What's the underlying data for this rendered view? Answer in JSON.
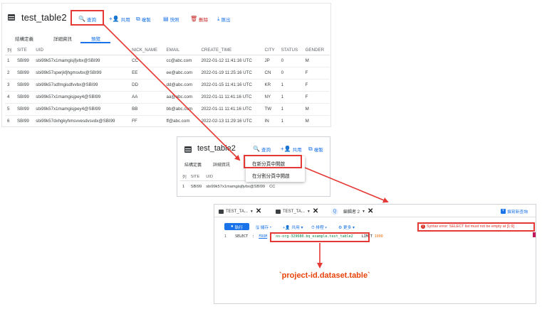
{
  "panel1": {
    "title": "test_table2",
    "toolbar": [
      {
        "label": "查詢",
        "icon": "search-icon",
        "glyph": "🔍"
      },
      {
        "label": "共用",
        "icon": "person-add-icon",
        "glyph": "+👤"
      },
      {
        "label": "複製",
        "icon": "copy-icon",
        "glyph": "⧉"
      },
      {
        "label": "快照",
        "icon": "snapshot-icon",
        "glyph": "▤"
      },
      {
        "label": "刪除",
        "icon": "delete-icon",
        "glyph": "🗑"
      },
      {
        "label": "匯出",
        "icon": "export-icon",
        "glyph": "⤓"
      }
    ],
    "subtabs": [
      "結構定義",
      "詳細資訊",
      "預覽"
    ],
    "selected_subtab": "預覽",
    "columns": [
      "列",
      "SITE",
      "UID",
      "NICK_NAME",
      "EMAIL",
      "CREATE_TIME",
      "CITY",
      "STATUS",
      "GENDER"
    ],
    "rows": [
      [
        "1",
        "SBI99",
        "sbi99k57x1mamgisjfjvbx@SBI99",
        "CC",
        "cc@abc.com",
        "2022-01-12 11:41:16 UTC",
        "JP",
        "0",
        "M"
      ],
      [
        "2",
        "SBI99",
        "sbi99k57sperjkfjhgmsvbx@SBI99",
        "EE",
        "ee@abc.com",
        "2022-01-19 11:25:16 UTC",
        "CN",
        "0",
        "F"
      ],
      [
        "3",
        "SBI99",
        "sbi99k57sdfmgisdfvvbx@SBI99",
        "DD",
        "dd@abc.com",
        "2022-01-15 11:41:16 UTC",
        "KR",
        "1",
        "F"
      ],
      [
        "4",
        "SBI99",
        "sbi99k57x1mamgisjpey4@SBI99",
        "AA",
        "aa@abc.com",
        "2022-01-11 11:41:16 UTC",
        "NY",
        "1",
        "F"
      ],
      [
        "5",
        "SBI99",
        "sbi99k57x1mamgisjpey4@SBI99",
        "BB",
        "bb@abc.com",
        "2022-01-11 11:41:16 UTC",
        "TW",
        "1",
        "M"
      ],
      [
        "6",
        "SBI99",
        "sbi99k57dxhgkyhmsvvesdvsvdx@SBI99",
        "FF",
        "ff@abc.com",
        "2022-02-13 11:29:16 UTC",
        "IN",
        "1",
        "M"
      ]
    ]
  },
  "panel2": {
    "title": "test_table2",
    "toolbar": [
      {
        "label": "查詢",
        "icon": "search-icon",
        "glyph": "🔍"
      },
      {
        "label": "共用",
        "icon": "person-add-icon",
        "glyph": "+👤"
      },
      {
        "label": "複製",
        "icon": "copy-icon",
        "glyph": "⧉"
      }
    ],
    "subtabs": [
      "結構定義",
      "詳細資訊"
    ],
    "columns": [
      "列",
      "SITE",
      "UID",
      "NICK_N"
    ],
    "rows": [
      [
        "1",
        "SBI99",
        "sbi99k57x1mamgisjfjvbx@SBI99",
        "CC"
      ]
    ],
    "menu": [
      "在新分頁中開啟",
      "在分割分頁中開啟"
    ]
  },
  "panel3": {
    "tabs": [
      {
        "label": "TEST_TA...",
        "icon": "table-icon"
      },
      {
        "label": "TEST_TA...",
        "icon": "table-icon"
      },
      {
        "label": "編輯者 2",
        "icon": "query-editor-icon"
      }
    ],
    "compose_label": "撰寫新查詢",
    "run_label": "執行",
    "toolbar": [
      {
        "label": "儲存",
        "icon": "save-icon",
        "glyph": "🖫"
      },
      {
        "label": "共用",
        "icon": "person-add-icon",
        "glyph": "+👤"
      },
      {
        "label": "排程",
        "icon": "schedule-icon",
        "glyph": "⏱"
      },
      {
        "label": "更多",
        "icon": "gear-icon",
        "glyph": "⚙"
      }
    ],
    "error_text": "Syntax error: SELECT list must not be empty at [1:9]",
    "code": {
      "line_no": "1",
      "select_kw": "SELECT",
      "from_kw": "FROM",
      "table_ref": "`ns-org-329680.bq_example.test_table2`",
      "limit_kw": "LIMIT",
      "limit_val": "1000"
    }
  },
  "annotation": "`project-id.dataset.table`",
  "colors": {
    "accent": "#1a73e8",
    "highlight": "#e53935",
    "annotation": "#e8430a"
  }
}
